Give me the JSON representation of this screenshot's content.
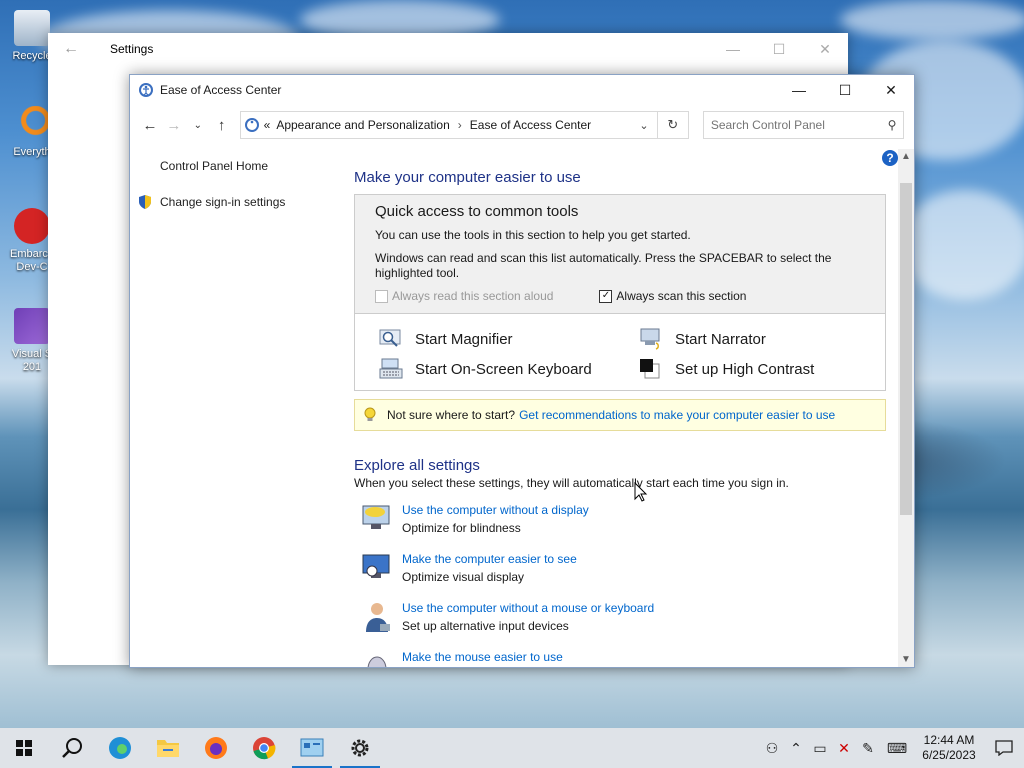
{
  "desktop": {
    "icons": [
      {
        "label": "Recycle"
      },
      {
        "label": "Everyth"
      },
      {
        "label": "Embarca Dev-C"
      },
      {
        "label": "Visual S 201"
      }
    ]
  },
  "settings_window": {
    "title": "Settings"
  },
  "cp_window": {
    "title": "Ease of Access Center",
    "breadcrumb_prefix": "«",
    "breadcrumb": [
      "Appearance and Personalization",
      "Ease of Access Center"
    ],
    "breadcrumb_sep": "›",
    "search_placeholder": "Search Control Panel",
    "left_nav": {
      "home": "Control Panel Home",
      "signin": "Change sign-in settings"
    },
    "heading": "Make your computer easier to use",
    "quick": {
      "title": "Quick access to common tools",
      "desc1": "You can use the tools in this section to help you get started.",
      "desc2": "Windows can read and scan this list automatically.  Press the SPACEBAR to select the highlighted tool.",
      "read_aloud": "Always read this section aloud",
      "read_aloud_checked": false,
      "scan": "Always scan this section",
      "scan_checked": true
    },
    "tools": {
      "magnifier": "Start Magnifier",
      "narrator": "Start Narrator",
      "osk": "Start On-Screen Keyboard",
      "contrast": "Set up High Contrast"
    },
    "tip": {
      "text": "Not sure where to start?",
      "link": "Get recommendations to make your computer easier to use"
    },
    "explore": {
      "title": "Explore all settings",
      "subtitle": "When you select these settings, they will automatically start each time you sign in.",
      "items": [
        {
          "link": "Use the computer without a display",
          "desc": "Optimize for blindness"
        },
        {
          "link": "Make the computer easier to see",
          "desc": "Optimize visual display"
        },
        {
          "link": "Use the computer without a mouse or keyboard",
          "desc": "Set up alternative input devices"
        },
        {
          "link": "Make the mouse easier to use",
          "desc": ""
        }
      ]
    }
  },
  "taskbar": {
    "time": "12:44 AM",
    "date": "6/25/2023"
  },
  "colors": {
    "accent": "#0066cc",
    "heading": "#1e3287",
    "taskbar": "#dfe3e8"
  }
}
